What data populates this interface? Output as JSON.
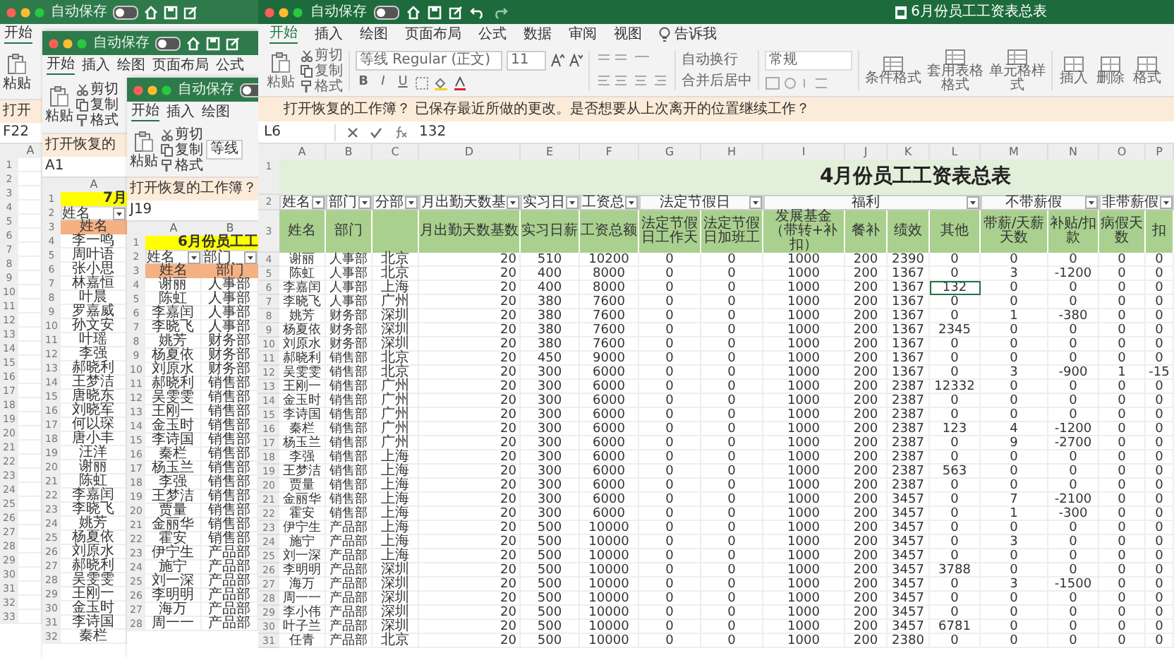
{
  "background_windows": [
    {
      "autosave": "自动保存",
      "autosave_on": false,
      "tabs": [
        {
          "label": "开始",
          "selected": true
        }
      ],
      "paste": "粘贴",
      "notice": "打开",
      "name_box": "F22",
      "columns": [
        "A"
      ],
      "rows": [
        {
          "row": "1"
        },
        {
          "row": "2"
        },
        {
          "row": "3"
        },
        {
          "row": "4"
        },
        {
          "row": "5"
        },
        {
          "row": "6"
        },
        {
          "row": "7"
        },
        {
          "row": "8"
        },
        {
          "row": "9"
        },
        {
          "row": "10"
        },
        {
          "row": "11"
        },
        {
          "row": "12"
        },
        {
          "row": "13"
        },
        {
          "row": "14"
        },
        {
          "row": "15"
        },
        {
          "row": "16"
        },
        {
          "row": "17"
        },
        {
          "row": "18"
        },
        {
          "row": "19"
        },
        {
          "row": "20"
        },
        {
          "row": "21"
        },
        {
          "row": "22"
        },
        {
          "row": "23"
        },
        {
          "row": "24"
        },
        {
          "row": "25"
        },
        {
          "row": "26"
        },
        {
          "row": "27"
        },
        {
          "row": "28"
        },
        {
          "row": "29"
        },
        {
          "row": "30"
        },
        {
          "row": "31"
        },
        {
          "row": "32"
        },
        {
          "row": "33"
        }
      ]
    },
    {
      "autosave": "自动保存",
      "autosave_on": false,
      "tabs": [
        {
          "label": "开始",
          "selected": true
        },
        {
          "label": "插入",
          "selected": false
        },
        {
          "label": "绘图",
          "selected": false
        },
        {
          "label": "页面布局",
          "selected": false
        },
        {
          "label": "公式",
          "selected": false
        }
      ],
      "paste": "粘贴",
      "clipboard": [
        "剪切",
        "复制",
        "格式"
      ],
      "notice": "打开恢复的",
      "name_box": "A1",
      "columns": [
        "A"
      ],
      "title_row": {
        "row": "1",
        "text": "7月"
      },
      "filter_row": {
        "row": "2",
        "items": [
          "姓名"
        ]
      },
      "header_row": {
        "row": "3",
        "items": [
          "姓名"
        ]
      },
      "rows": [
        {
          "row": "4",
          "cells": [
            "李一鸣"
          ]
        },
        {
          "row": "5",
          "cells": [
            "周叶语"
          ]
        },
        {
          "row": "6",
          "cells": [
            "张小思"
          ]
        },
        {
          "row": "7",
          "cells": [
            "林嘉恒"
          ]
        },
        {
          "row": "8",
          "cells": [
            "叶晨"
          ]
        },
        {
          "row": "9",
          "cells": [
            "罗嘉威"
          ]
        },
        {
          "row": "10",
          "cells": [
            "孙文安"
          ]
        },
        {
          "row": "11",
          "cells": [
            "叶瑶"
          ]
        },
        {
          "row": "12",
          "cells": [
            "李强"
          ]
        },
        {
          "row": "13",
          "cells": [
            "郝晓利"
          ]
        },
        {
          "row": "14",
          "cells": [
            "王梦洁"
          ]
        },
        {
          "row": "15",
          "cells": [
            "唐晓东"
          ]
        },
        {
          "row": "16",
          "cells": [
            "刘晓军"
          ]
        },
        {
          "row": "17",
          "cells": [
            "何以琛"
          ]
        },
        {
          "row": "18",
          "cells": [
            "唐小丰"
          ]
        },
        {
          "row": "19",
          "cells": [
            "汪洋"
          ]
        },
        {
          "row": "20",
          "cells": [
            "谢丽"
          ]
        },
        {
          "row": "21",
          "cells": [
            "陈虹"
          ]
        },
        {
          "row": "22",
          "cells": [
            "李嘉闰"
          ]
        },
        {
          "row": "23",
          "cells": [
            "李晓飞"
          ]
        },
        {
          "row": "24",
          "cells": [
            "姚芳"
          ]
        },
        {
          "row": "25",
          "cells": [
            "杨夏依"
          ]
        },
        {
          "row": "26",
          "cells": [
            "刘原水"
          ]
        },
        {
          "row": "27",
          "cells": [
            "郝晓利"
          ]
        },
        {
          "row": "28",
          "cells": [
            "吴雯雯"
          ]
        },
        {
          "row": "29",
          "cells": [
            "王刚一"
          ]
        },
        {
          "row": "30",
          "cells": [
            "金玉时"
          ]
        },
        {
          "row": "31",
          "cells": [
            "李诗国"
          ]
        },
        {
          "row": "32",
          "cells": [
            "秦栏"
          ]
        }
      ]
    },
    {
      "autosave": "自动保存",
      "autosave_on": false,
      "tabs": [
        {
          "label": "开始",
          "selected": true
        },
        {
          "label": "插入",
          "selected": false
        },
        {
          "label": "绘图",
          "selected": false
        }
      ],
      "paste": "粘贴",
      "clipboard": [
        "剪切",
        "复制",
        "格式"
      ],
      "font": "等线",
      "notice": "打开恢复的工作簿？",
      "name_box": "J19",
      "columns": [
        "A",
        "B"
      ],
      "title_row": {
        "row": "1",
        "text": "6月份员工工"
      },
      "filter_row": {
        "row": "2",
        "items": [
          "姓名",
          "部门"
        ]
      },
      "header_row": {
        "row": "3",
        "items": [
          "姓名",
          "部门"
        ]
      },
      "rows": [
        {
          "row": "4",
          "cells": [
            "谢丽",
            "人事部"
          ]
        },
        {
          "row": "5",
          "cells": [
            "陈虹",
            "人事部"
          ]
        },
        {
          "row": "6",
          "cells": [
            "李嘉闰",
            "人事部"
          ]
        },
        {
          "row": "7",
          "cells": [
            "李晓飞",
            "人事部"
          ]
        },
        {
          "row": "8",
          "cells": [
            "姚芳",
            "财务部"
          ]
        },
        {
          "row": "9",
          "cells": [
            "杨夏依",
            "财务部"
          ]
        },
        {
          "row": "10",
          "cells": [
            "刘原水",
            "财务部"
          ]
        },
        {
          "row": "11",
          "cells": [
            "郝晓利",
            "销售部"
          ]
        },
        {
          "row": "12",
          "cells": [
            "吴雯雯",
            "销售部"
          ]
        },
        {
          "row": "13",
          "cells": [
            "王刚一",
            "销售部"
          ]
        },
        {
          "row": "14",
          "cells": [
            "金玉时",
            "销售部"
          ]
        },
        {
          "row": "15",
          "cells": [
            "李诗国",
            "销售部"
          ]
        },
        {
          "row": "16",
          "cells": [
            "秦栏",
            "销售部"
          ]
        },
        {
          "row": "17",
          "cells": [
            "杨玉兰",
            "销售部"
          ]
        },
        {
          "row": "18",
          "cells": [
            "李强",
            "销售部"
          ]
        },
        {
          "row": "19",
          "cells": [
            "王梦洁",
            "销售部"
          ]
        },
        {
          "row": "20",
          "cells": [
            "贾量",
            "销售部"
          ]
        },
        {
          "row": "21",
          "cells": [
            "金丽华",
            "销售部"
          ]
        },
        {
          "row": "22",
          "cells": [
            "霍安",
            "销售部"
          ]
        },
        {
          "row": "23",
          "cells": [
            "伊宁生",
            "产品部"
          ]
        },
        {
          "row": "24",
          "cells": [
            "施宁",
            "产品部"
          ]
        },
        {
          "row": "25",
          "cells": [
            "刘一深",
            "产品部"
          ]
        },
        {
          "row": "26",
          "cells": [
            "李明明",
            "产品部"
          ]
        },
        {
          "row": "27",
          "cells": [
            "海万",
            "产品部"
          ]
        },
        {
          "row": "28",
          "cells": [
            "周一一",
            "产品部"
          ]
        }
      ]
    }
  ],
  "window": {
    "autosave": "自动保存",
    "autosave_on": false,
    "title": "6月份员工工资表总表"
  },
  "tabs": [
    {
      "label": "开始",
      "selected": true,
      "kind": "tab"
    },
    {
      "label": "插入",
      "selected": false,
      "kind": "tab"
    },
    {
      "label": "绘图",
      "selected": false,
      "kind": "tab"
    },
    {
      "label": "页面布局",
      "selected": false,
      "kind": "tab"
    },
    {
      "label": "公式",
      "selected": false,
      "kind": "tab"
    },
    {
      "label": "数据",
      "selected": false,
      "kind": "tab"
    },
    {
      "label": "审阅",
      "selected": false,
      "kind": "tab"
    },
    {
      "label": "视图",
      "selected": false,
      "kind": "tab"
    },
    {
      "label": "告诉我",
      "selected": false,
      "kind": "tell"
    }
  ],
  "ribbon": {
    "paste": "粘贴",
    "clipboard": [
      "剪切",
      "复制",
      "格式"
    ],
    "font": "等线 Regular (正文)",
    "size": "11",
    "font_buttons": [
      "B",
      "I",
      "U"
    ],
    "wrap": "自动换行",
    "merge": "合并后居中",
    "number_format": "常规",
    "styles": [
      "条件格式",
      "套用表格格式",
      "单元格样式"
    ],
    "cells": [
      "插入",
      "删除",
      "格式"
    ]
  },
  "notice": "打开恢复的工作簿？ 已保存最近所做的更改。是否想要从上次离开的位置继续工作？",
  "formula_bar": {
    "name_box": "L6",
    "value": "132"
  },
  "table": {
    "columns": [
      "A",
      "B",
      "C",
      "D",
      "E",
      "F",
      "G",
      "H",
      "I",
      "J",
      "K",
      "L",
      "M",
      "N",
      "O",
      "P"
    ],
    "title_row": {
      "row": "1",
      "text": "4月份员工工资表总表"
    },
    "filter_row": {
      "row": "2",
      "items": [
        "姓名",
        "部门",
        "分部",
        "月出勤天数基",
        "实习日",
        "工资总",
        "法定节假日",
        "福利",
        "不带薪假",
        "非带薪假"
      ]
    },
    "header_row": {
      "row": "3",
      "items": [
        "姓名",
        "部门",
        "月出勤天数基数",
        "实习日薪",
        "工资总额",
        "法定节假日工作天",
        "法定节假日加班工",
        "发展基金（带转+补扣）",
        "餐补",
        "绩效",
        "其他",
        "带薪/天薪天数",
        "补贴/扣款",
        "病假天数",
        "扣"
      ]
    },
    "rows": [
      {
        "row": "4",
        "selected": false,
        "cells": [
          "谢丽",
          "人事部",
          "北京",
          "20",
          "510",
          "10200",
          "0",
          "0",
          "1000",
          "200",
          "2390",
          "0",
          "0",
          "0",
          "0",
          "0"
        ]
      },
      {
        "row": "5",
        "selected": false,
        "cells": [
          "陈虹",
          "人事部",
          "北京",
          "20",
          "400",
          "8000",
          "0",
          "0",
          "1000",
          "200",
          "1367",
          "0",
          "3",
          "-1200",
          "0",
          "0"
        ]
      },
      {
        "row": "6",
        "selected": true,
        "cells": [
          "李嘉闰",
          "人事部",
          "上海",
          "20",
          "400",
          "8000",
          "0",
          "0",
          "1000",
          "200",
          "1367",
          "132",
          "0",
          "0",
          "0",
          "0"
        ]
      },
      {
        "row": "7",
        "selected": false,
        "cells": [
          "李晓飞",
          "人事部",
          "广州",
          "20",
          "380",
          "7600",
          "0",
          "0",
          "1000",
          "200",
          "1367",
          "0",
          "0",
          "0",
          "0",
          "0"
        ]
      },
      {
        "row": "8",
        "selected": false,
        "cells": [
          "姚芳",
          "财务部",
          "深圳",
          "20",
          "380",
          "7600",
          "0",
          "0",
          "1000",
          "200",
          "1367",
          "0",
          "1",
          "-380",
          "0",
          "0"
        ]
      },
      {
        "row": "9",
        "selected": false,
        "cells": [
          "杨夏依",
          "财务部",
          "深圳",
          "20",
          "380",
          "7600",
          "0",
          "0",
          "1000",
          "200",
          "1367",
          "2345",
          "0",
          "0",
          "0",
          "0"
        ]
      },
      {
        "row": "10",
        "selected": false,
        "cells": [
          "刘原水",
          "财务部",
          "深圳",
          "20",
          "380",
          "7600",
          "0",
          "0",
          "1000",
          "200",
          "1367",
          "0",
          "0",
          "0",
          "0",
          "0"
        ]
      },
      {
        "row": "11",
        "selected": false,
        "cells": [
          "郝晓利",
          "销售部",
          "北京",
          "20",
          "450",
          "9000",
          "0",
          "0",
          "1000",
          "200",
          "1367",
          "0",
          "0",
          "0",
          "0",
          "0"
        ]
      },
      {
        "row": "12",
        "selected": false,
        "cells": [
          "吴雯雯",
          "销售部",
          "北京",
          "20",
          "300",
          "6000",
          "0",
          "0",
          "1000",
          "200",
          "1367",
          "0",
          "3",
          "-900",
          "1",
          "-15"
        ]
      },
      {
        "row": "13",
        "selected": false,
        "cells": [
          "王刚一",
          "销售部",
          "广州",
          "20",
          "300",
          "6000",
          "0",
          "0",
          "1000",
          "200",
          "2387",
          "12332",
          "0",
          "0",
          "0",
          "0"
        ]
      },
      {
        "row": "14",
        "selected": false,
        "cells": [
          "金玉时",
          "销售部",
          "广州",
          "20",
          "300",
          "6000",
          "0",
          "0",
          "1000",
          "200",
          "2387",
          "0",
          "0",
          "0",
          "0",
          "0"
        ]
      },
      {
        "row": "15",
        "selected": false,
        "cells": [
          "李诗国",
          "销售部",
          "广州",
          "20",
          "300",
          "6000",
          "0",
          "0",
          "1000",
          "200",
          "2387",
          "0",
          "0",
          "0",
          "0",
          "0"
        ]
      },
      {
        "row": "16",
        "selected": false,
        "cells": [
          "秦栏",
          "销售部",
          "广州",
          "20",
          "300",
          "6000",
          "0",
          "0",
          "1000",
          "200",
          "2387",
          "123",
          "4",
          "-1200",
          "0",
          "0"
        ]
      },
      {
        "row": "17",
        "selected": false,
        "cells": [
          "杨玉兰",
          "销售部",
          "广州",
          "20",
          "300",
          "6000",
          "0",
          "0",
          "1000",
          "200",
          "2387",
          "0",
          "9",
          "-2700",
          "0",
          "0"
        ]
      },
      {
        "row": "18",
        "selected": false,
        "cells": [
          "李强",
          "销售部",
          "上海",
          "20",
          "300",
          "6000",
          "0",
          "0",
          "1000",
          "200",
          "2387",
          "0",
          "0",
          "0",
          "0",
          "0"
        ]
      },
      {
        "row": "19",
        "selected": false,
        "cells": [
          "王梦洁",
          "销售部",
          "上海",
          "20",
          "300",
          "6000",
          "0",
          "0",
          "1000",
          "200",
          "2387",
          "563",
          "0",
          "0",
          "0",
          "0"
        ]
      },
      {
        "row": "20",
        "selected": false,
        "cells": [
          "贾量",
          "销售部",
          "上海",
          "20",
          "300",
          "6000",
          "0",
          "0",
          "1000",
          "200",
          "2387",
          "0",
          "0",
          "0",
          "0",
          "0"
        ]
      },
      {
        "row": "21",
        "selected": false,
        "cells": [
          "金丽华",
          "销售部",
          "上海",
          "20",
          "300",
          "6000",
          "0",
          "0",
          "1000",
          "200",
          "3457",
          "0",
          "7",
          "-2100",
          "0",
          "0"
        ]
      },
      {
        "row": "22",
        "selected": false,
        "cells": [
          "霍安",
          "销售部",
          "上海",
          "20",
          "300",
          "6000",
          "0",
          "0",
          "1000",
          "200",
          "3457",
          "0",
          "1",
          "-300",
          "0",
          "0"
        ]
      },
      {
        "row": "23",
        "selected": false,
        "cells": [
          "伊宁生",
          "产品部",
          "上海",
          "20",
          "500",
          "10000",
          "0",
          "0",
          "1000",
          "200",
          "3457",
          "0",
          "0",
          "0",
          "0",
          "0"
        ]
      },
      {
        "row": "24",
        "selected": false,
        "cells": [
          "施宁",
          "产品部",
          "上海",
          "20",
          "500",
          "10000",
          "0",
          "0",
          "1000",
          "200",
          "3457",
          "0",
          "3",
          "0",
          "0",
          "0"
        ]
      },
      {
        "row": "25",
        "selected": false,
        "cells": [
          "刘一深",
          "产品部",
          "上海",
          "20",
          "500",
          "10000",
          "0",
          "0",
          "1000",
          "200",
          "3457",
          "0",
          "0",
          "0",
          "0",
          "0"
        ]
      },
      {
        "row": "26",
        "selected": false,
        "cells": [
          "李明明",
          "产品部",
          "深圳",
          "20",
          "500",
          "10000",
          "0",
          "0",
          "1000",
          "200",
          "3457",
          "3788",
          "0",
          "0",
          "0",
          "0"
        ]
      },
      {
        "row": "27",
        "selected": false,
        "cells": [
          "海万",
          "产品部",
          "深圳",
          "20",
          "500",
          "10000",
          "0",
          "0",
          "1000",
          "200",
          "3457",
          "0",
          "3",
          "-1500",
          "0",
          "0"
        ]
      },
      {
        "row": "28",
        "selected": false,
        "cells": [
          "周一一",
          "产品部",
          "深圳",
          "20",
          "500",
          "10000",
          "0",
          "0",
          "1000",
          "200",
          "3457",
          "0",
          "0",
          "0",
          "0",
          "0"
        ]
      },
      {
        "row": "29",
        "selected": false,
        "cells": [
          "李小伟",
          "产品部",
          "深圳",
          "20",
          "500",
          "10000",
          "0",
          "0",
          "1000",
          "200",
          "3457",
          "0",
          "0",
          "0",
          "0",
          "0"
        ]
      },
      {
        "row": "30",
        "selected": false,
        "cells": [
          "叶子兰",
          "产品部",
          "深圳",
          "20",
          "500",
          "10000",
          "0",
          "0",
          "1000",
          "200",
          "3457",
          "6781",
          "0",
          "0",
          "0",
          "0"
        ]
      },
      {
        "row": "31",
        "selected": false,
        "cells": [
          "任青",
          "产品部",
          "北京",
          "20",
          "500",
          "10000",
          "0",
          "0",
          "1000",
          "200",
          "2380",
          "0",
          "0",
          "0",
          "0",
          "0"
        ]
      }
    ]
  }
}
